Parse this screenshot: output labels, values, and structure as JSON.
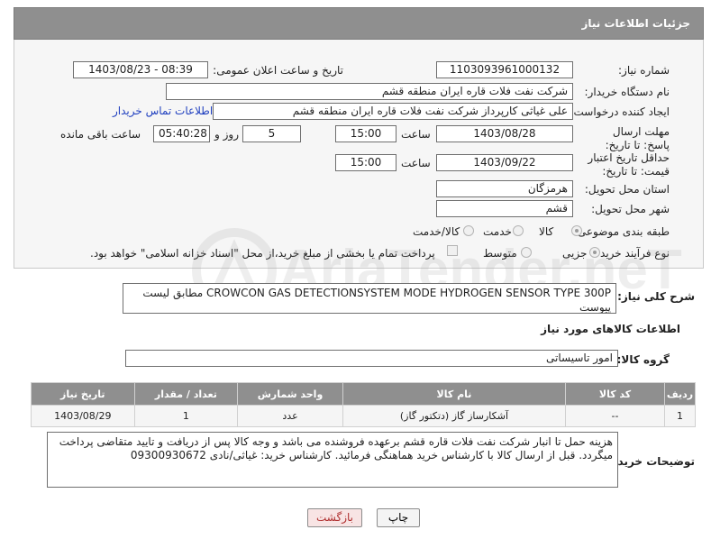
{
  "header": {
    "title": "جزئیات اطلاعات نیاز"
  },
  "labels": {
    "need_number": "شماره نیاز:",
    "announce_datetime": "تاریخ و ساعت اعلان عمومی:",
    "buyer_org": "نام دستگاه خریدار:",
    "requester": "ایجاد کننده درخواست:",
    "reply_deadline": "مهلت ارسال پاسخ: تا تاریخ:",
    "price_validity": "حداقل تاریخ اعتبار قیمت: تا تاریخ:",
    "hour": "ساعت",
    "day_and": "روز و",
    "remaining": "ساعت باقی مانده",
    "province": "استان محل تحویل:",
    "city": "شهر محل تحویل:",
    "category": "طبقه بندی موضوعی:",
    "process_type": "نوع فرآیند خرید :",
    "general_desc": "شرح کلی نیاز:",
    "goods_info": "اطلاعات کالاهای مورد نیاز",
    "goods_group": "گروه کالا:",
    "buyer_notes": "توضیحات خریدار:"
  },
  "fields": {
    "need_number": "1103093961000132",
    "announce_datetime": "1403/08/23 - 08:39",
    "buyer_org": "شرکت نفت فلات قاره ایران منطقه قشم",
    "requester": "علی غیاثی کارپرداز شرکت نفت فلات قاره ایران منطقه قشم",
    "contact_link": "اطلاعات تماس خریدار",
    "reply_date": "1403/08/28",
    "reply_hour": "15:00",
    "reply_days": "5",
    "reply_remaining": "05:40:28",
    "validity_date": "1403/09/22",
    "validity_hour": "15:00",
    "province": "هرمزگان",
    "city": "قشم",
    "general_desc": "CROWCON GAS DETECTIONSYSTEM MODE HYDROGEN SENSOR TYPE 300P مطابق لیست پیوست",
    "goods_group": "امور تاسیساتی",
    "buyer_notes": "هزینه حمل تا انبار شرکت نفت فلات قاره قشم برعهده فروشنده می باشد و وجه کالا پس از دریافت و تایید متقاضی پرداخت میگردد. قبل از ارسال کالا با کارشناس خرید هماهنگی فرمائید. کارشناس خرید: غیاثی/نادی 09300930672"
  },
  "category_options": [
    "کالا",
    "خدمت",
    "کالا/خدمت"
  ],
  "process_options": [
    "جزیی",
    "متوسط"
  ],
  "treasury_note": "پرداخت تمام یا بخشی از مبلغ خرید،از محل \"اسناد خزانه اسلامی\" خواهد بود.",
  "table": {
    "headers": [
      "ردیف",
      "کد کالا",
      "نام کالا",
      "واحد شمارش",
      "تعداد / مقدار",
      "تاریخ نیاز"
    ],
    "rows": [
      [
        "1",
        "--",
        "آشکارساز گاز (دتکتور گاز)",
        "عدد",
        "1",
        "1403/08/29"
      ]
    ]
  },
  "buttons": {
    "print": "چاپ",
    "back": "بازگشت"
  },
  "watermark": {
    "text": "AriaTender.neT"
  }
}
